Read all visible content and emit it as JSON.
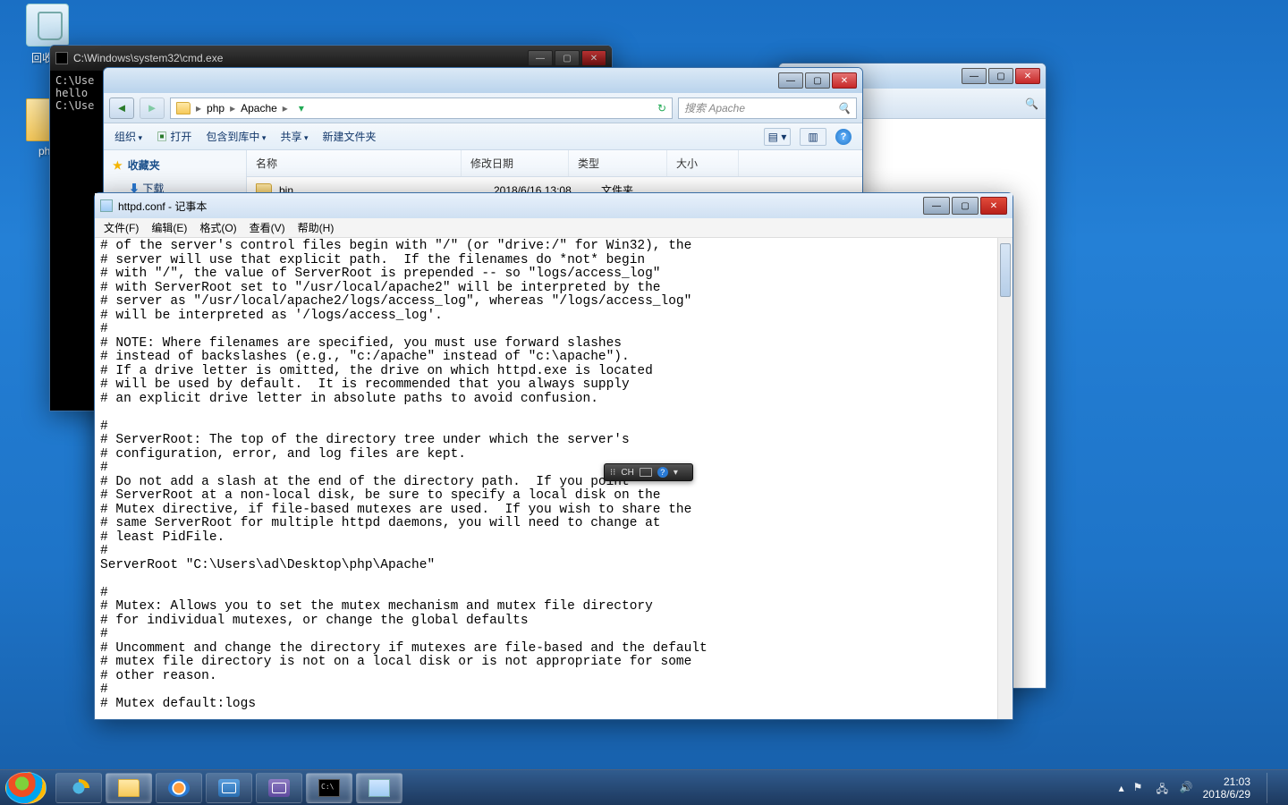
{
  "desktop": {
    "recycle_label": "回收站",
    "php_label": "php"
  },
  "cmd": {
    "title": "C:\\Windows\\system32\\cmd.exe",
    "lines": "C:\\Use\nhello\nC:\\Use"
  },
  "explorer": {
    "breadcrumb": {
      "seg1": "php",
      "seg2": "Apache"
    },
    "search_placeholder": "搜索 Apache",
    "toolbar": {
      "organize": "组织",
      "open": "打开",
      "include": "包含到库中",
      "share": "共享",
      "newfolder": "新建文件夹"
    },
    "sidebar": {
      "favorites": "收藏夹",
      "downloads": "下载"
    },
    "columns": {
      "name": "名称",
      "date": "修改日期",
      "type": "类型",
      "size": "大小"
    },
    "rows": [
      {
        "name": "bin",
        "date": "2018/6/16 13:08",
        "type": "文件夹",
        "size": ""
      }
    ]
  },
  "notepad": {
    "title": "httpd.conf - 记事本",
    "menu": {
      "file": "文件(F)",
      "edit": "编辑(E)",
      "format": "格式(O)",
      "view": "查看(V)",
      "help": "帮助(H)"
    },
    "content": "# of the server's control files begin with \"/\" (or \"drive:/\" for Win32), the\n# server will use that explicit path.  If the filenames do *not* begin\n# with \"/\", the value of ServerRoot is prepended -- so \"logs/access_log\"\n# with ServerRoot set to \"/usr/local/apache2\" will be interpreted by the\n# server as \"/usr/local/apache2/logs/access_log\", whereas \"/logs/access_log\"\n# will be interpreted as '/logs/access_log'.\n#\n# NOTE: Where filenames are specified, you must use forward slashes\n# instead of backslashes (e.g., \"c:/apache\" instead of \"c:\\apache\").\n# If a drive letter is omitted, the drive on which httpd.exe is located\n# will be used by default.  It is recommended that you always supply\n# an explicit drive letter in absolute paths to avoid confusion.\n\n#\n# ServerRoot: The top of the directory tree under which the server's\n# configuration, error, and log files are kept.\n#\n# Do not add a slash at the end of the directory path.  If you point\n# ServerRoot at a non-local disk, be sure to specify a local disk on the\n# Mutex directive, if file-based mutexes are used.  If you wish to share the\n# same ServerRoot for multiple httpd daemons, you will need to change at\n# least PidFile.\n#\nServerRoot \"C:\\Users\\ad\\Desktop\\php\\Apache\"\n\n#\n# Mutex: Allows you to set the mutex mechanism and mutex file directory\n# for individual mutexes, or change the global defaults\n#\n# Uncomment and change the directory if mutexes are file-based and the default\n# mutex file directory is not on a local disk or is not appropriate for some\n# other reason.\n#\n# Mutex default:logs"
  },
  "ime": {
    "label": "CH"
  },
  "taskbar": {
    "time": "21:03",
    "date": "2018/6/29"
  }
}
